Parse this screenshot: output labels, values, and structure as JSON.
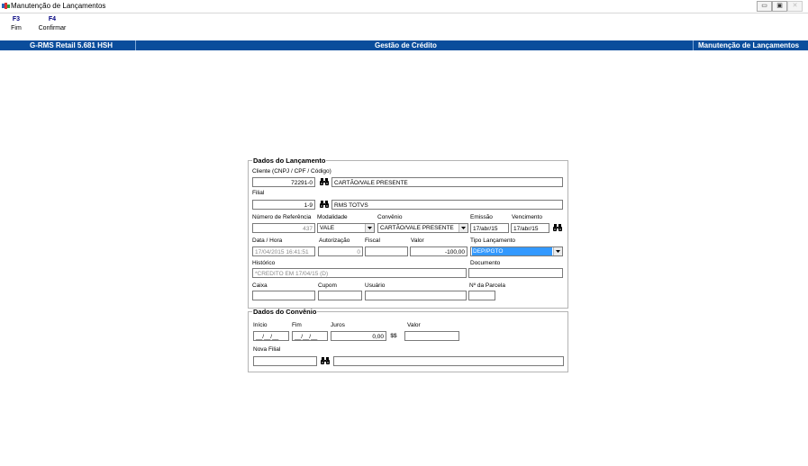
{
  "window": {
    "title": "Manutenção de Lançamentos",
    "min_glyph": "▭",
    "max_glyph": "▣",
    "close_glyph": "✕"
  },
  "toolbar": {
    "f3_key": "F3",
    "f3_label": "Fim",
    "f4_key": "F4",
    "f4_label": "Confirmar"
  },
  "header": {
    "app": "G-RMS Retail 5.681 HSH",
    "module": "Gestão de Crédito",
    "screen": "Manutenção de Lançamentos"
  },
  "dados_lancamento": {
    "legend": "Dados do Lançamento",
    "cliente_label": "Cliente (CNPJ / CPF / Código)",
    "cliente_value": "72291-0",
    "cliente_name": "CARTÃO/VALE PRESENTE",
    "filial_label": "Filial",
    "filial_value": "1-9",
    "filial_name": "RMS TOTVS",
    "num_ref_label": "Número de Referência",
    "num_ref_value": "437",
    "modalidade_label": "Modalidade",
    "modalidade_value": "VALE",
    "convenio_label": "Convênio",
    "convenio_value": "CARTÃO/VALE PRESENTE",
    "emissao_label": "Emissão",
    "emissao_value": "17/abr/15",
    "vencimento_label": "Vencimento",
    "vencimento_value": "17/abr/15",
    "data_hora_label": "Data / Hora",
    "data_hora_value": "17/04/2015 16:41:51",
    "autorizacao_label": "Autorização",
    "autorizacao_value": "0",
    "fiscal_label": "Fiscal",
    "fiscal_value": "",
    "valor_label": "Valor",
    "valor_value": "-100,00",
    "tipo_lanc_label": "Tipo Lançamento",
    "tipo_lanc_value": "DEP/PGTO",
    "historico_label": "Histórico",
    "historico_value": "*CREDITO EM 17/04/15 (D)",
    "documento_label": "Documento",
    "documento_value": "",
    "caixa_label": "Caixa",
    "caixa_value": "",
    "cupom_label": "Cupom",
    "cupom_value": "",
    "usuario_label": "Usuário",
    "usuario_value": "",
    "parcela_label": "Nº da Parcela",
    "parcela_value": ""
  },
  "dados_convenio": {
    "legend": "Dados do Convênio",
    "inicio_label": "Início",
    "inicio_value": "__/__/__",
    "fim_label": "Fim",
    "fim_value": "__/__/__",
    "juros_label": "Juros",
    "juros_value": "0,00",
    "calc_glyph": "$$",
    "valor_label": "Valor",
    "valor_value": "",
    "nova_filial_label": "Nova Filial",
    "nova_filial_value": "",
    "nova_filial_name": ""
  },
  "colors": {
    "header_bg": "#0a4d9c",
    "selection": "#3399ff",
    "key_text": "#00007f"
  }
}
